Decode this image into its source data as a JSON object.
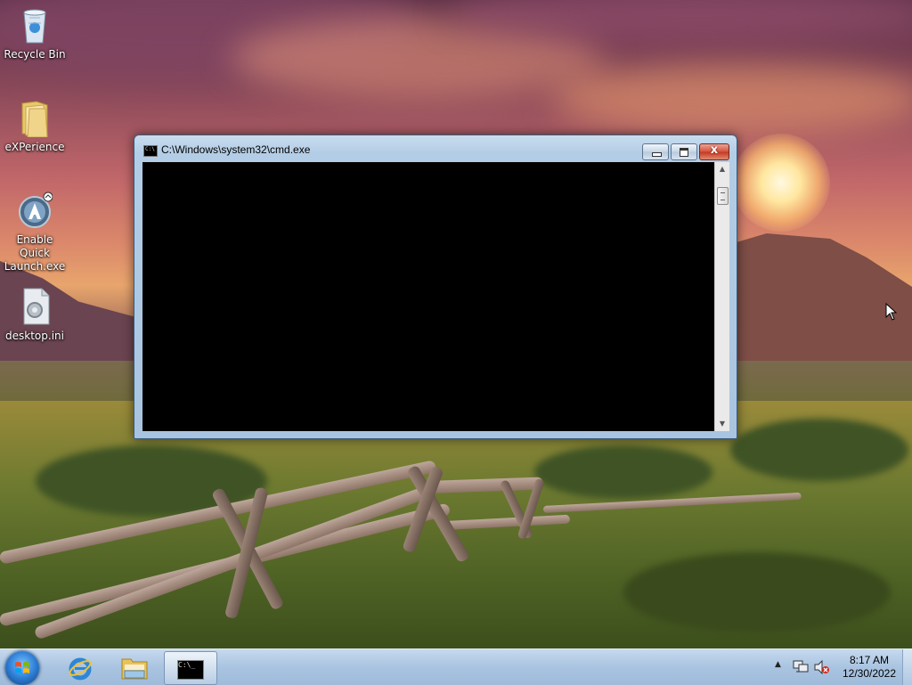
{
  "desktop": {
    "icons": [
      {
        "label": "Recycle Bin",
        "icon": "recycle-bin-icon"
      },
      {
        "label": "eXPerience",
        "icon": "folder-icon"
      },
      {
        "label": "Enable Quick Launch.exe",
        "icon": "app-icon"
      },
      {
        "label": "desktop.ini",
        "icon": "settings-file-icon"
      }
    ]
  },
  "window": {
    "title": "C:\\Windows\\system32\\cmd.exe",
    "console_text": "",
    "close_glyph": "x",
    "scroll_up": "▲",
    "scroll_down": "▼"
  },
  "taskbar": {
    "start": {
      "icon": "windows-logo-icon"
    },
    "pinned": [
      {
        "name": "Internet Explorer",
        "icon": "ie-icon"
      },
      {
        "name": "Windows Explorer",
        "icon": "explorer-icon"
      },
      {
        "name": "Command Prompt",
        "icon": "cmd-icon",
        "active": true
      }
    ],
    "cmd_glyph": "C:\\_",
    "tray": {
      "arrow": "▲",
      "network_icon": "network-icon",
      "volume_icon": "volume-muted-icon",
      "time": "8:17 AM",
      "date": "12/30/2022"
    }
  },
  "colors": {
    "console_bg": "#000000",
    "close_button": "#c4371f",
    "taskbar": "#a9c4e1"
  }
}
